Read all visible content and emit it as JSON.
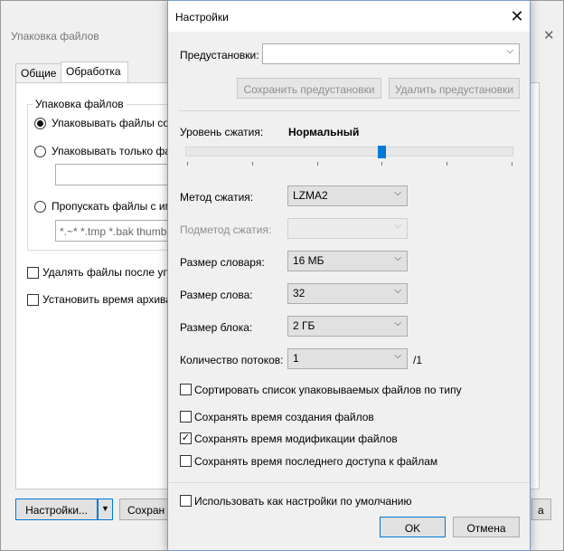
{
  "background_window": {
    "title": "Упаковка файлов",
    "close_glyph": "✕",
    "tabs": [
      {
        "label": "Общие",
        "active": false
      },
      {
        "label": "Обработка",
        "active": true
      }
    ],
    "group": {
      "title": "Упаковка файлов",
      "options": [
        {
          "label": "Упаковывать файлы со",
          "checked": true
        },
        {
          "label": "Упаковывать только фа",
          "checked": false
        },
        {
          "label": "Пропускать файлы с им",
          "checked": false
        }
      ],
      "mask_value": "",
      "skip_mask_value": "*.~* *.tmp *.bak thumb"
    },
    "checks": [
      {
        "label": "Удалять файлы после упа",
        "checked": false
      },
      {
        "label": "Установить время архива",
        "checked": false
      }
    ],
    "settings_button": "Настройки...",
    "dropdown_glyph": "▼",
    "save_button": "Сохран",
    "right_button": "а"
  },
  "dialog": {
    "title": "Настройки",
    "close_glyph": "✕",
    "presets_label": "Предустановки:",
    "presets_value": "",
    "save_presets_button": "Сохранить предустановки",
    "delete_presets_button": "Удалить предустановки",
    "compression_level_label": "Уровень сжатия:",
    "compression_level_value": "Нормальный",
    "compression_level_fraction": 0.6,
    "chevron_glyph": "⌵",
    "fields": [
      {
        "label": "Метод сжатия:",
        "value": "LZMA2",
        "disabled": false
      },
      {
        "label": "Подметод сжатия:",
        "value": "",
        "disabled": true
      },
      {
        "label": "Размер словаря:",
        "value": "16 МБ",
        "disabled": false
      },
      {
        "label": "Размер слова:",
        "value": "32",
        "disabled": false
      },
      {
        "label": "Размер блока:",
        "value": "2 ГБ",
        "disabled": false
      },
      {
        "label": "Количество потоков:",
        "value": "1",
        "disabled": false
      }
    ],
    "threads_suffix": "/1",
    "options": [
      {
        "label": "Сортировать список упаковываемых файлов по типу",
        "checked": false
      },
      {
        "label": "Сохранять время создания файлов",
        "checked": false
      },
      {
        "label": "Сохранять время модификации файлов",
        "checked": true
      },
      {
        "label": "Сохранять время последнего доступа к файлам",
        "checked": false
      }
    ],
    "check_glyph": "✓",
    "default_option": {
      "label": "Использовать как настройки по умолчанию",
      "checked": false
    },
    "ok_button": "OK",
    "cancel_button": "Отмена"
  }
}
